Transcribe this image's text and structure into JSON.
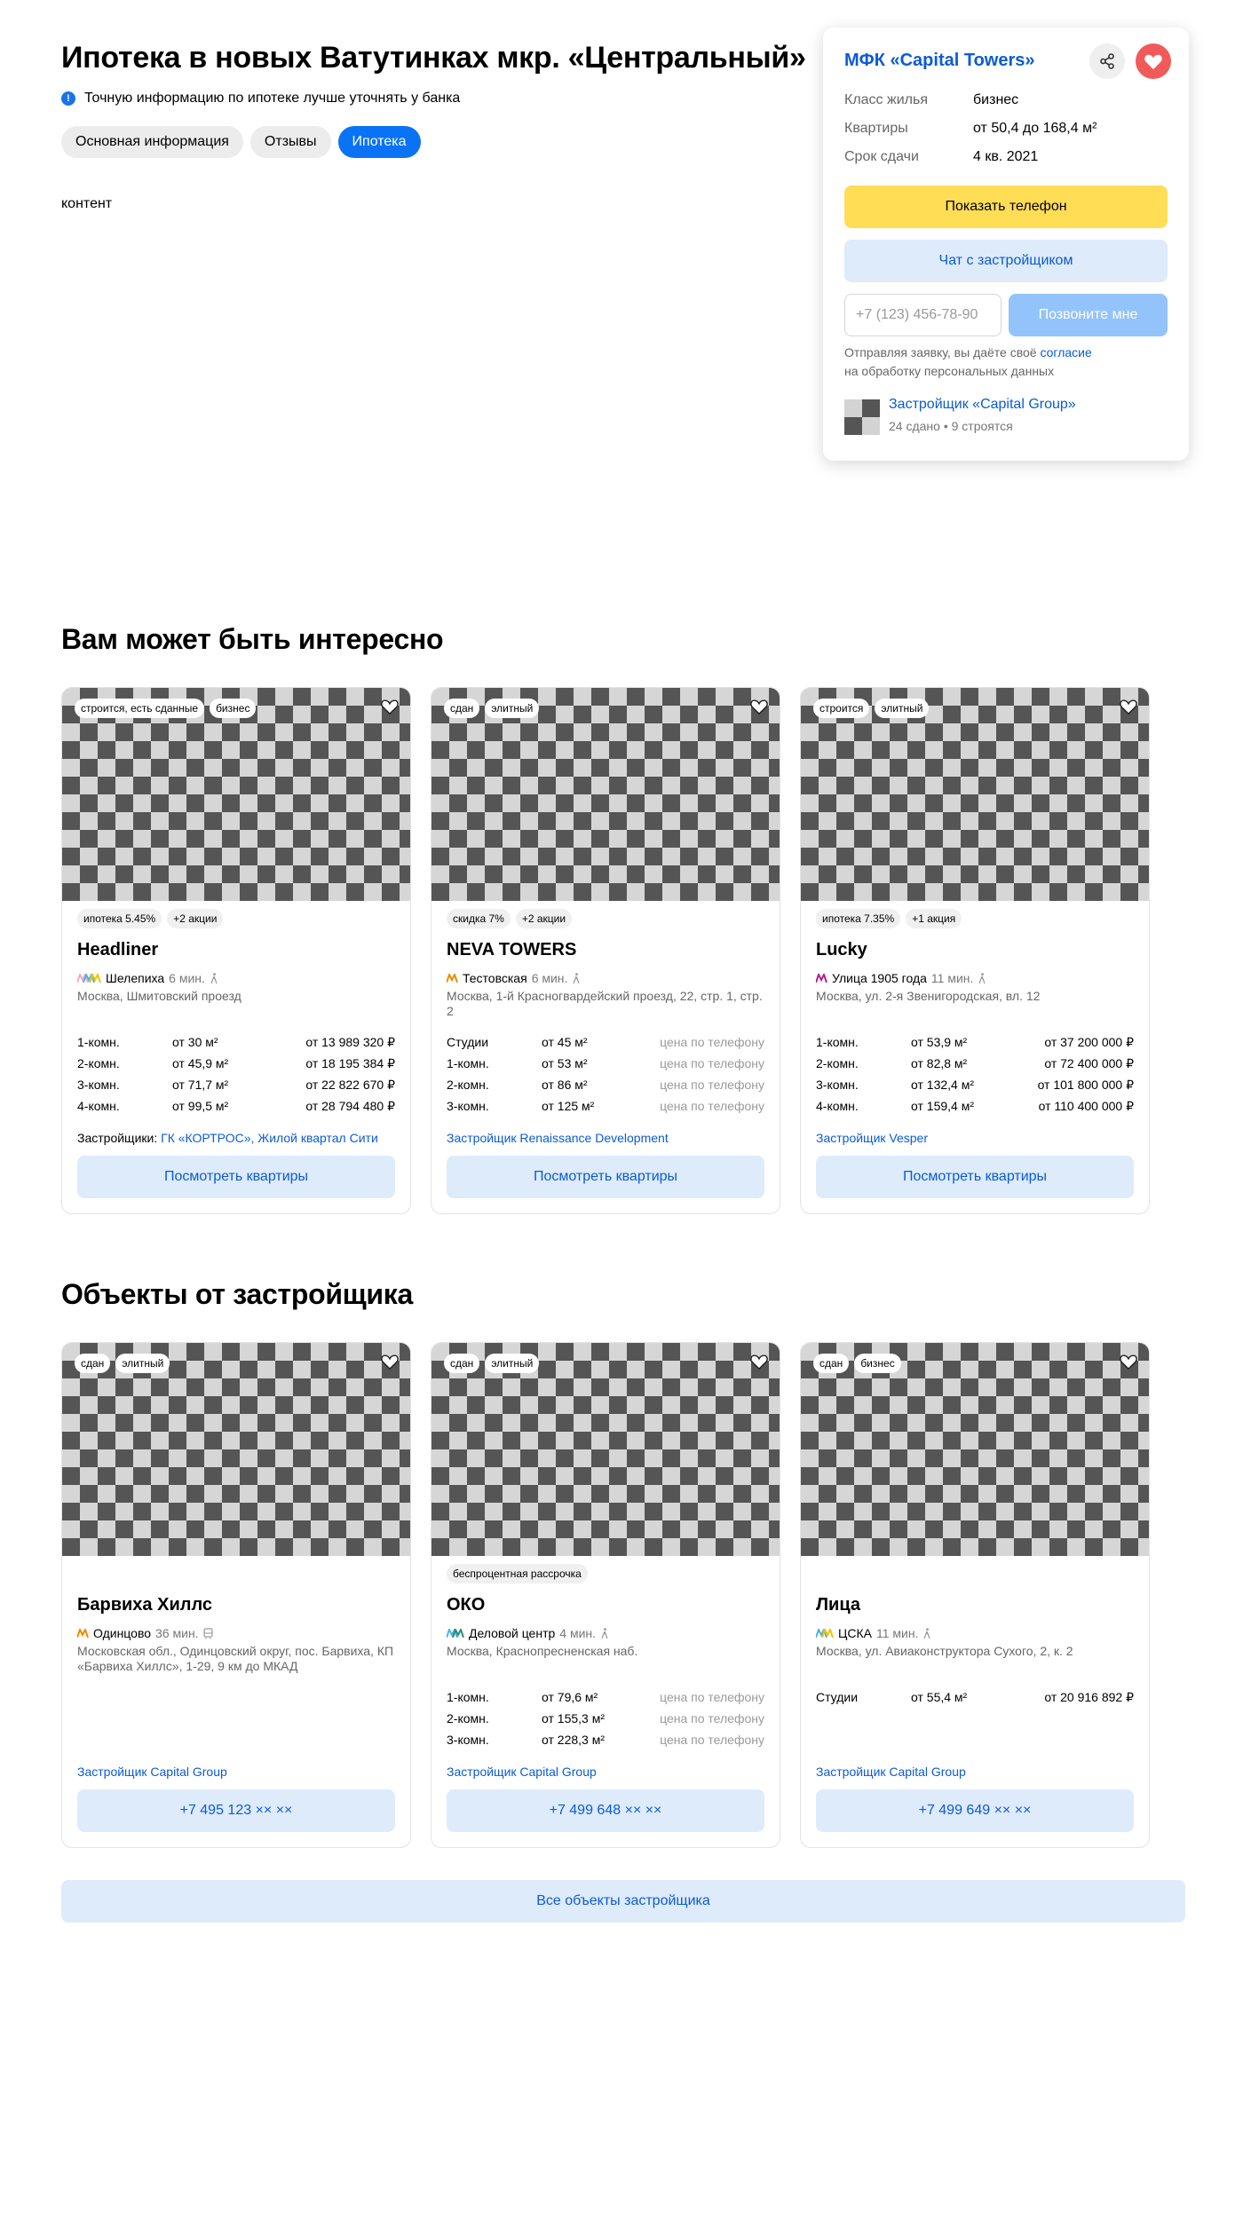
{
  "header": {
    "title": "Ипотека в новых Ватутинках мкр. «Центральный»",
    "info_icon": "info-icon",
    "info_text": "Точную информацию по ипотеке лучше уточнять у банка",
    "tabs": [
      {
        "label": "Основная информация",
        "active": false
      },
      {
        "label": "Отзывы",
        "active": false
      },
      {
        "label": "Ипотека",
        "active": true
      }
    ],
    "content": "контент"
  },
  "side_card": {
    "name": "МФК «Capital Towers»",
    "share_icon": "share-icon",
    "favorite_icon": "heart-icon",
    "rows": [
      {
        "key": "Класс жилья",
        "value": "бизнес"
      },
      {
        "key": "Квартиры",
        "value": "от 50,4 до 168,4 м²"
      },
      {
        "key": "Срок сдачи",
        "value": "4 кв. 2021"
      }
    ],
    "show_phone": "Показать телефон",
    "chat": "Чат с застройщиком",
    "phone_placeholder": "+7 (123) 456-78-90",
    "call_me": "Позвоните мне",
    "consent_prefix": "Отправляя заявку, вы даёте своё",
    "consent_link": "согласие",
    "consent_suffix": "на обработку персональных данных",
    "developer": "Застройщик «Capital Group»",
    "developer_stats": "24 сдано • 9 строятся"
  },
  "interesting": {
    "title": "Вам может быть интересно",
    "cards": [
      {
        "tags": [
          "строится, есть сданные",
          "бизнес"
        ],
        "promos": [
          "ипотека 5.45%",
          "+2 акции"
        ],
        "title": "Headliner",
        "metro": "Шелепиха",
        "metro_colors": [
          "#f4a6c8",
          "#4db3e6",
          "#f5c200"
        ],
        "walk": "6 мин.",
        "address": "Москва, Шмитовский проезд",
        "flats": [
          {
            "type": "1-комн.",
            "area": "от 30 м²",
            "price": "от 13 989 320 ₽",
            "muted": false
          },
          {
            "type": "2-комн.",
            "area": "от 45,9 м²",
            "price": "от 18 195 384 ₽",
            "muted": false
          },
          {
            "type": "3-комн.",
            "area": "от 71,7 м²",
            "price": "от 22 822 670 ₽",
            "muted": false
          },
          {
            "type": "4-комн.",
            "area": "от 99,5 м²",
            "price": "от 28 794 480 ₽",
            "muted": false
          }
        ],
        "dev_prefix": "Застройщики:",
        "dev_links": "ГК «КОРТРОС», Жилой квартал Сити",
        "button": "Посмотреть квартиры"
      },
      {
        "tags": [
          "сдан",
          "элитный"
        ],
        "promos": [
          "скидка 7%",
          "+2 акции"
        ],
        "title": "NEVA TOWERS",
        "metro": "Тестовская",
        "metro_colors": [
          "#f08c00"
        ],
        "walk": "6 мин.",
        "address": "Москва, 1-й Красногвардейский проезд, 22, стр. 1, стр. 2",
        "flats": [
          {
            "type": "Студии",
            "area": "от 45 м²",
            "price": "цена по телефону",
            "muted": true
          },
          {
            "type": "1-комн.",
            "area": "от 53 м²",
            "price": "цена по телефону",
            "muted": true
          },
          {
            "type": "2-комн.",
            "area": "от 86 м²",
            "price": "цена по телефону",
            "muted": true
          },
          {
            "type": "3-комн.",
            "area": "от 125 м²",
            "price": "цена по телефону",
            "muted": true
          }
        ],
        "dev_prefix": "",
        "dev_links": "Застройщик Renaissance Development",
        "button": "Посмотреть квартиры"
      },
      {
        "tags": [
          "строится",
          "элитный"
        ],
        "promos": [
          "ипотека 7.35%",
          "+1 акция"
        ],
        "title": "Lucky",
        "metro": "Улица 1905 года",
        "metro_colors": [
          "#b0208e"
        ],
        "walk": "11 мин.",
        "address": "Москва, ул. 2-я Звенигородская, вл. 12",
        "flats": [
          {
            "type": "1-комн.",
            "area": "от 53,9 м²",
            "price": "от 37 200 000 ₽",
            "muted": false
          },
          {
            "type": "2-комн.",
            "area": "от 82,8 м²",
            "price": "от 72 400 000 ₽",
            "muted": false
          },
          {
            "type": "3-комн.",
            "area": "от 132,4 м²",
            "price": "от 101 800 000 ₽",
            "muted": false
          },
          {
            "type": "4-комн.",
            "area": "от 159,4 м²",
            "price": "от 110 400 000 ₽",
            "muted": false
          }
        ],
        "dev_prefix": "",
        "dev_links": "Застройщик Vesper",
        "button": "Посмотреть квартиры"
      }
    ]
  },
  "developer_objects": {
    "title": "Объекты от застройщика",
    "cards": [
      {
        "tags": [
          "сдан",
          "элитный"
        ],
        "promos": [],
        "title": "Барвиха Хиллс",
        "metro": "Одинцово",
        "metro_colors": [
          "#f08c00"
        ],
        "walk": "36 мин.",
        "address": "Московская обл., Одинцовский округ, пос. Барвиха, КП «Барвиха Хиллс», 1-29, 9 км до МКАД",
        "flats": [],
        "dev_prefix": "",
        "dev_links": "Застройщик Capital Group",
        "button": "+7 495 123 ×× ××"
      },
      {
        "tags": [
          "сдан",
          "элитный"
        ],
        "promos": [
          "беспроцентная рассрочка"
        ],
        "title": "ОКО",
        "metro": "Деловой центр",
        "metro_colors": [
          "#4db3e6",
          "#2a8f7f"
        ],
        "walk": "4 мин.",
        "address": "Москва, Краснопресненская наб.",
        "flats": [
          {
            "type": "1-комн.",
            "area": "от 79,6 м²",
            "price": "цена по телефону",
            "muted": true
          },
          {
            "type": "2-комн.",
            "area": "от 155,3 м²",
            "price": "цена по телефону",
            "muted": true
          },
          {
            "type": "3-комн.",
            "area": "от 228,3 м²",
            "price": "цена по телефону",
            "muted": true
          }
        ],
        "dev_prefix": "",
        "dev_links": "Застройщик Capital Group",
        "button": "+7 499 648 ×× ××"
      },
      {
        "tags": [
          "сдан",
          "бизнес"
        ],
        "promos": [],
        "title": "Лица",
        "metro": "ЦСКА",
        "metro_colors": [
          "#4db3e6",
          "#f5c200"
        ],
        "walk": "11 мин.",
        "address": "Москва, ул. Авиаконструктора Сухого, 2, к. 2",
        "flats": [
          {
            "type": "Студии",
            "area": "от 55,4 м²",
            "price": "от 20 916 892 ₽",
            "muted": false
          }
        ],
        "dev_prefix": "",
        "dev_links": "Застройщик Capital Group",
        "button": "+7 499 649 ×× ××"
      }
    ],
    "all_button": "Все объекты застройщика"
  }
}
